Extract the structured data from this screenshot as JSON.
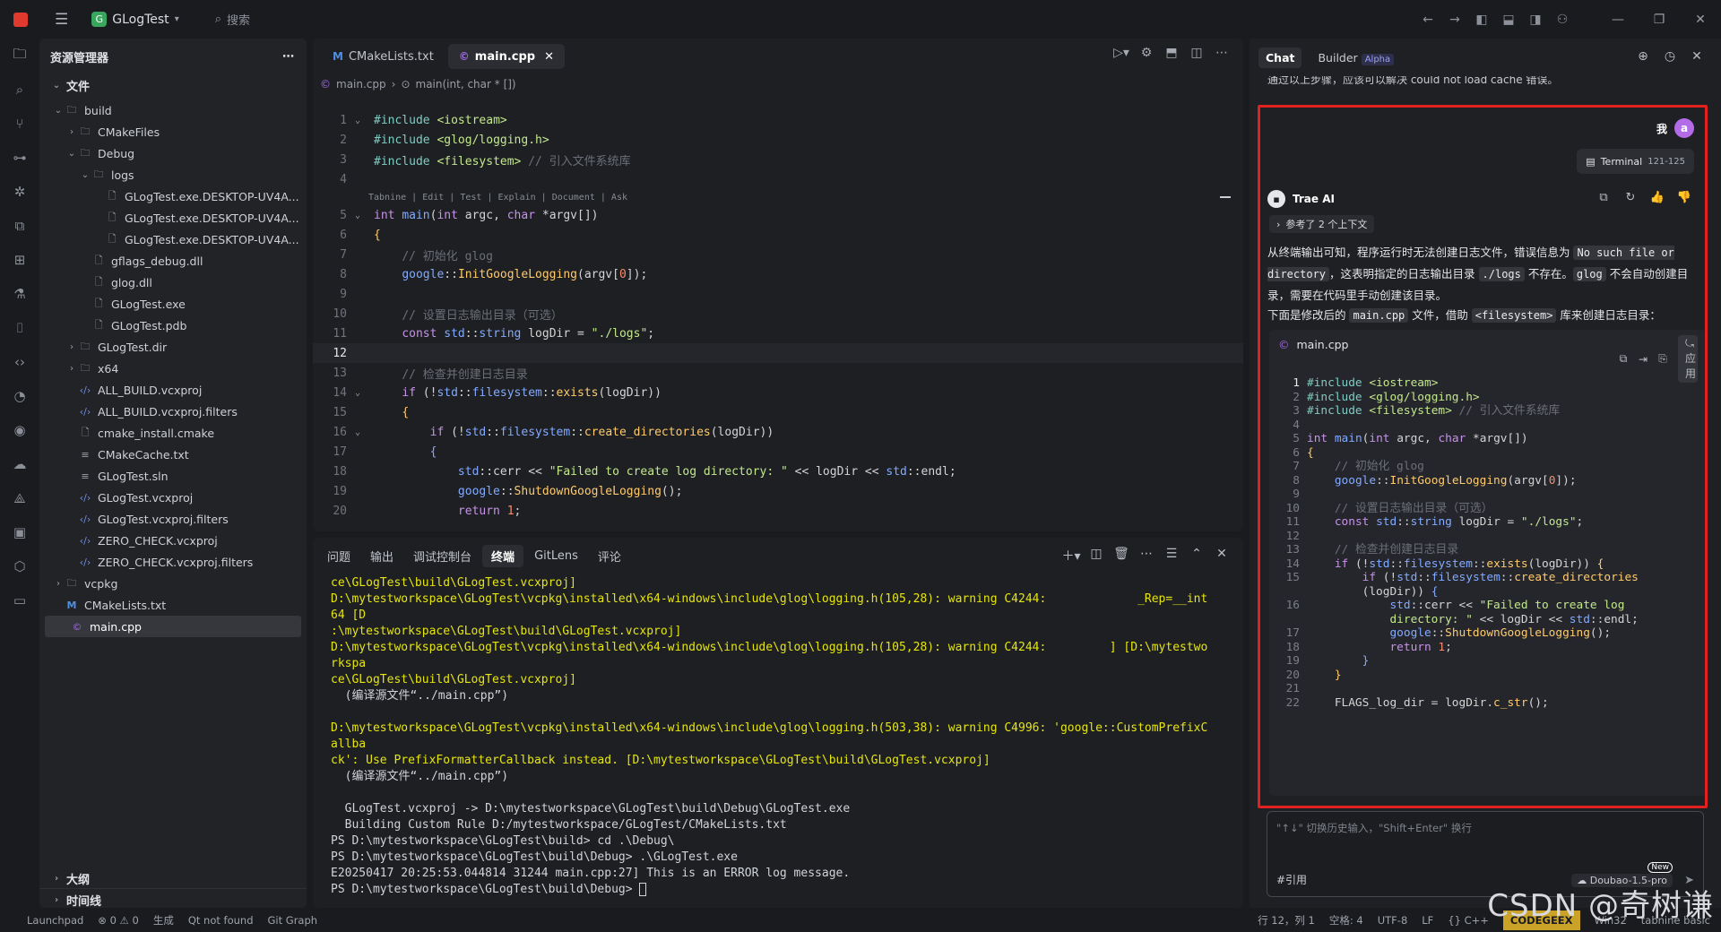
{
  "app": {
    "project": "GLogTest",
    "project_initial": "G",
    "search_label": "搜索"
  },
  "explorer": {
    "title": "资源管理器",
    "section": "文件",
    "tree": [
      {
        "label": "build",
        "depth": 0,
        "kind": "folder",
        "open": true
      },
      {
        "label": "CMakeFiles",
        "depth": 1,
        "kind": "folder",
        "open": false
      },
      {
        "label": "Debug",
        "depth": 1,
        "kind": "folder",
        "open": true
      },
      {
        "label": "logs",
        "depth": 2,
        "kind": "folder",
        "open": true
      },
      {
        "label": "GLogTest.exe.DESKTOP-UV4A...",
        "depth": 3,
        "kind": "file"
      },
      {
        "label": "GLogTest.exe.DESKTOP-UV4A...",
        "depth": 3,
        "kind": "file"
      },
      {
        "label": "GLogTest.exe.DESKTOP-UV4A...",
        "depth": 3,
        "kind": "file"
      },
      {
        "label": "gflags_debug.dll",
        "depth": 2,
        "kind": "file"
      },
      {
        "label": "glog.dll",
        "depth": 2,
        "kind": "file"
      },
      {
        "label": "GLogTest.exe",
        "depth": 2,
        "kind": "file"
      },
      {
        "label": "GLogTest.pdb",
        "depth": 2,
        "kind": "file"
      },
      {
        "label": "GLogTest.dir",
        "depth": 1,
        "kind": "folder",
        "open": false
      },
      {
        "label": "x64",
        "depth": 1,
        "kind": "folder",
        "open": false
      },
      {
        "label": "ALL_BUILD.vcxproj",
        "depth": 1,
        "kind": "xml"
      },
      {
        "label": "ALL_BUILD.vcxproj.filters",
        "depth": 1,
        "kind": "xml"
      },
      {
        "label": "cmake_install.cmake",
        "depth": 1,
        "kind": "file"
      },
      {
        "label": "CMakeCache.txt",
        "depth": 1,
        "kind": "text"
      },
      {
        "label": "GLogTest.sln",
        "depth": 1,
        "kind": "text"
      },
      {
        "label": "GLogTest.vcxproj",
        "depth": 1,
        "kind": "xml"
      },
      {
        "label": "GLogTest.vcxproj.filters",
        "depth": 1,
        "kind": "xml"
      },
      {
        "label": "ZERO_CHECK.vcxproj",
        "depth": 1,
        "kind": "xml"
      },
      {
        "label": "ZERO_CHECK.vcxproj.filters",
        "depth": 1,
        "kind": "xml"
      },
      {
        "label": "vcpkg",
        "depth": 0,
        "kind": "folder",
        "open": false
      },
      {
        "label": "CMakeLists.txt",
        "depth": 0,
        "kind": "cmake"
      },
      {
        "label": "main.cpp",
        "depth": 0,
        "kind": "cpp",
        "selected": true
      }
    ],
    "outline": "大纲",
    "timeline": "时间线"
  },
  "editor": {
    "tabs": [
      {
        "label": "CMakeLists.txt",
        "active": false,
        "icon": "M"
      },
      {
        "label": "main.cpp",
        "active": true,
        "icon": "©"
      }
    ],
    "breadcrumb": [
      "main.cpp",
      "main(int, char * [])"
    ],
    "hint": "Tabnine | Edit | Test | Explain | Document | Ask",
    "current_line": 12,
    "lines": [
      {
        "n": 1,
        "fold": "v",
        "html": "<span class='pp'>#include</span> <span class='str'>&lt;iostream&gt;</span>"
      },
      {
        "n": 2,
        "fold": "",
        "html": "<span class='pp'>#include</span> <span class='str'>&lt;glog/logging.h&gt;</span>"
      },
      {
        "n": 3,
        "fold": "",
        "html": "<span class='pp'>#include</span> <span class='str'>&lt;filesystem&gt;</span> <span class='com'>// 引入文件系统库</span>"
      },
      {
        "n": 4,
        "fold": "",
        "html": ""
      },
      {
        "n": 5,
        "fold": "v",
        "html": "<span class='kw'>int</span> <span class='ty'>main</span>(<span class='kw'>int</span> argc, <span class='kw'>char</span> *argv[])"
      },
      {
        "n": 6,
        "fold": "",
        "html": "<span class='fn'>{</span>"
      },
      {
        "n": 7,
        "fold": "",
        "html": "    <span class='com'>// 初始化 glog</span>"
      },
      {
        "n": 8,
        "fold": "",
        "html": "    <span class='ty'>google</span>::<span class='fn'>InitGoogleLogging</span>(argv[<span class='num'>0</span>]);"
      },
      {
        "n": 9,
        "fold": "",
        "html": ""
      },
      {
        "n": 10,
        "fold": "",
        "html": "    <span class='com'>// 设置日志输出目录（可选）</span>"
      },
      {
        "n": 11,
        "fold": "",
        "html": "    <span class='kw'>const</span> <span class='ty'>std</span>::<span class='ty'>string</span> logDir = <span class='str'>\"./logs\"</span>;"
      },
      {
        "n": 12,
        "fold": "",
        "html": ""
      },
      {
        "n": 13,
        "fold": "",
        "html": "    <span class='com'>// 检查并创建日志目录</span>"
      },
      {
        "n": 14,
        "fold": "v",
        "html": "    <span class='kw'>if</span> (!<span class='ty'>std</span>::<span class='ty'>filesystem</span>::<span class='fn'>exists</span>(logDir))"
      },
      {
        "n": 15,
        "fold": "",
        "html": "    <span class='fn'>{</span>"
      },
      {
        "n": 16,
        "fold": "v",
        "html": "        <span class='kw'>if</span> (!<span class='ty'>std</span>::<span class='ty'>filesystem</span>::<span class='fn'>create_directories</span>(logDir))"
      },
      {
        "n": 17,
        "fold": "",
        "html": "        <span class='ty'>{</span>"
      },
      {
        "n": 18,
        "fold": "",
        "html": "            <span class='ty'>std</span>::cerr &lt;&lt; <span class='str'>\"Failed to create log directory: \"</span> &lt;&lt; logDir &lt;&lt; <span class='ty'>std</span>::endl;"
      },
      {
        "n": 19,
        "fold": "",
        "html": "            <span class='ty'>google</span>::<span class='fn'>ShutdownGoogleLogging</span>();"
      },
      {
        "n": 20,
        "fold": "",
        "html": "            <span class='kw'>return</span> <span class='num'>1</span>;"
      }
    ]
  },
  "terminal": {
    "tabs": [
      "问题",
      "输出",
      "调试控制台",
      "终端",
      "GitLens",
      "评论"
    ],
    "active_tab": "终端",
    "lines": [
      {
        "t": "ce\\GLogTest\\build\\GLogTest.vcxproj]",
        "y": true
      },
      {
        "t": "D:\\mytestworkspace\\GLogTest\\vcpkg\\installed\\x64-windows\\include\\glog\\logging.h(105,28): warning C4244:             _Rep=__int",
        "y": true
      },
      {
        "t": "64 [D",
        "y": true
      },
      {
        "t": ":\\mytestworkspace\\GLogTest\\build\\GLogTest.vcxproj]",
        "y": true
      },
      {
        "t": "D:\\mytestworkspace\\GLogTest\\vcpkg\\installed\\x64-windows\\include\\glog\\logging.h(105,28): warning C4244:         ] [D:\\mytestwo",
        "y": true
      },
      {
        "t": "rkspa",
        "y": true
      },
      {
        "t": "ce\\GLogTest\\build\\GLogTest.vcxproj]",
        "y": true
      },
      {
        "t": "  (编译源文件“../main.cpp”)",
        "y": false
      },
      {
        "t": "",
        "y": false
      },
      {
        "t": "D:\\mytestworkspace\\GLogTest\\vcpkg\\installed\\x64-windows\\include\\glog\\logging.h(503,38): warning C4996: 'google::CustomPrefixC",
        "y": true
      },
      {
        "t": "allba",
        "y": true
      },
      {
        "t": "ck': Use PrefixFormatterCallback instead. [D:\\mytestworkspace\\GLogTest\\build\\GLogTest.vcxproj]",
        "y": true
      },
      {
        "t": "  (编译源文件“../main.cpp”)",
        "y": false
      },
      {
        "t": "",
        "y": false
      },
      {
        "t": "  GLogTest.vcxproj -> D:\\mytestworkspace\\GLogTest\\build\\Debug\\GLogTest.exe",
        "y": false
      },
      {
        "t": "  Building Custom Rule D:/mytestworkspace/GLogTest/CMakeLists.txt",
        "y": false
      },
      {
        "t": "PS D:\\mytestworkspace\\GLogTest\\build> cd .\\Debug\\",
        "y": false
      },
      {
        "t": "PS D:\\mytestworkspace\\GLogTest\\build\\Debug> .\\GLogTest.exe",
        "y": false
      },
      {
        "t": "E20250417 20:25:53.044814 31244 main.cpp:27] This is an ERROR log message.",
        "y": false
      },
      {
        "t": "PS D:\\mytestworkspace\\GLogTest\\build\\Debug> ",
        "y": false,
        "cursor": true
      }
    ]
  },
  "chat": {
    "tabs": [
      {
        "label": "Chat",
        "active": true
      },
      {
        "label": "Builder",
        "active": false,
        "badge": "Alpha"
      }
    ],
    "top_clip": "通过以上步骤，应该可以解决 could not load cache 错误。",
    "user_label": "我",
    "user_avatar": "a",
    "terminal_chip": "Terminal",
    "terminal_range": "121-125",
    "ai_name": "Trae AI",
    "context_label": "参考了 2 个上下文",
    "para1": [
      {
        "t": "从终端输出可知，程序运行时无法创建日志文件，错误信息为 ",
        "c": false
      },
      {
        "t": "No such file or directory",
        "c": true
      },
      {
        "t": "，这表明指定的日志输出目录 ",
        "c": false
      },
      {
        "t": "./logs",
        "c": true
      },
      {
        "t": " 不存在。",
        "c": false
      },
      {
        "t": "glog",
        "c": true
      },
      {
        "t": " 不会自动创建目录，需要在代码里手动创建该目录。",
        "c": false
      }
    ],
    "para2": [
      {
        "t": "下面是修改后的 ",
        "c": false
      },
      {
        "t": "main.cpp",
        "c": true
      },
      {
        "t": " 文件，借助 ",
        "c": false
      },
      {
        "t": "<filesystem>",
        "c": true
      },
      {
        "t": " 库来创建日志目录：",
        "c": false
      }
    ],
    "code_file": "main.cpp",
    "apply_label": "应用",
    "code": [
      {
        "n": "1",
        "html": "<span class='pp'>#include</span> <span class='str'>&lt;iostream&gt;</span>"
      },
      {
        "n": "2",
        "html": "<span class='pp'>#include</span> <span class='str'>&lt;glog/logging.h&gt;</span>"
      },
      {
        "n": "3",
        "html": "<span class='pp'>#include</span> <span class='str'>&lt;filesystem&gt;</span> <span class='com'>// 引入文件系统库</span>"
      },
      {
        "n": "4",
        "html": ""
      },
      {
        "n": "5",
        "html": "<span class='kw'>int</span> <span class='ty'>main</span>(<span class='kw'>int</span> argc, <span class='kw'>char</span> *argv[])"
      },
      {
        "n": "6",
        "html": "<span class='fn'>{</span>"
      },
      {
        "n": "7",
        "html": "    <span class='com'>// 初始化 glog</span>"
      },
      {
        "n": "8",
        "html": "    <span class='ty'>google</span>::<span class='fn'>InitGoogleLogging</span>(argv[<span class='num'>0</span>]);"
      },
      {
        "n": "9",
        "html": ""
      },
      {
        "n": "10",
        "html": "    <span class='com'>// 设置日志输出目录（可选）</span>"
      },
      {
        "n": "11",
        "html": "    <span class='kw'>const</span> <span class='ty'>std</span>::<span class='ty'>string</span> logDir = <span class='str'>\"./logs\"</span>;"
      },
      {
        "n": "12",
        "html": ""
      },
      {
        "n": "13",
        "html": "    <span class='com'>// 检查并创建日志目录</span>"
      },
      {
        "n": "14",
        "html": "    <span class='kw'>if</span> (!<span class='ty'>std</span>::<span class='ty'>filesystem</span>::<span class='fn'>exists</span>(logDir)) <span class='fn'>{</span>"
      },
      {
        "n": "15",
        "html": "        <span class='kw'>if</span> (!<span class='ty'>std</span>::<span class='ty'>filesystem</span>::<span class='fn'>create_directories</span>"
      },
      {
        "n": "",
        "html": "        (logDir)) <span class='ty'>{</span>"
      },
      {
        "n": "16",
        "html": "            <span class='ty'>std</span>::cerr &lt;&lt; <span class='str'>\"Failed to create log</span>"
      },
      {
        "n": "",
        "html": "            <span class='str'>directory: \"</span> &lt;&lt; logDir &lt;&lt; <span class='ty'>std</span>::endl;"
      },
      {
        "n": "17",
        "html": "            <span class='ty'>google</span>::<span class='fn'>ShutdownGoogleLogging</span>();"
      },
      {
        "n": "18",
        "html": "            <span class='kw'>return</span> <span class='num'>1</span>;"
      },
      {
        "n": "19",
        "html": "        <span class='ty'>}</span>"
      },
      {
        "n": "20",
        "html": "    <span class='fn'>}</span>"
      },
      {
        "n": "21",
        "html": ""
      },
      {
        "n": "22",
        "html": "    FLAGS_log_dir = logDir.<span class='fn'>c_str</span>();"
      }
    ],
    "input_placeholder": "\"↑↓\" 切换历史输入，\"Shift+Enter\" 换行",
    "ref_label": "#引用",
    "model": "Doubao-1.5-pro",
    "new_badge": "New"
  },
  "status": {
    "left": [
      "Launchpad",
      "⊗ 0 ⚠ 0",
      "生成",
      "Qt not found",
      "Git Graph"
    ],
    "right": [
      "行 12，列 1",
      "空格: 4",
      "UTF-8",
      "LF",
      "{} C++",
      "CODEGEEX",
      "Win32",
      "tabnine basic"
    ]
  },
  "watermark": "CSDN @奇树谦",
  "colors": {
    "accent_red": "#e0211f",
    "codegeex": "#c9a227",
    "terminal_warning": "#e5e510"
  }
}
